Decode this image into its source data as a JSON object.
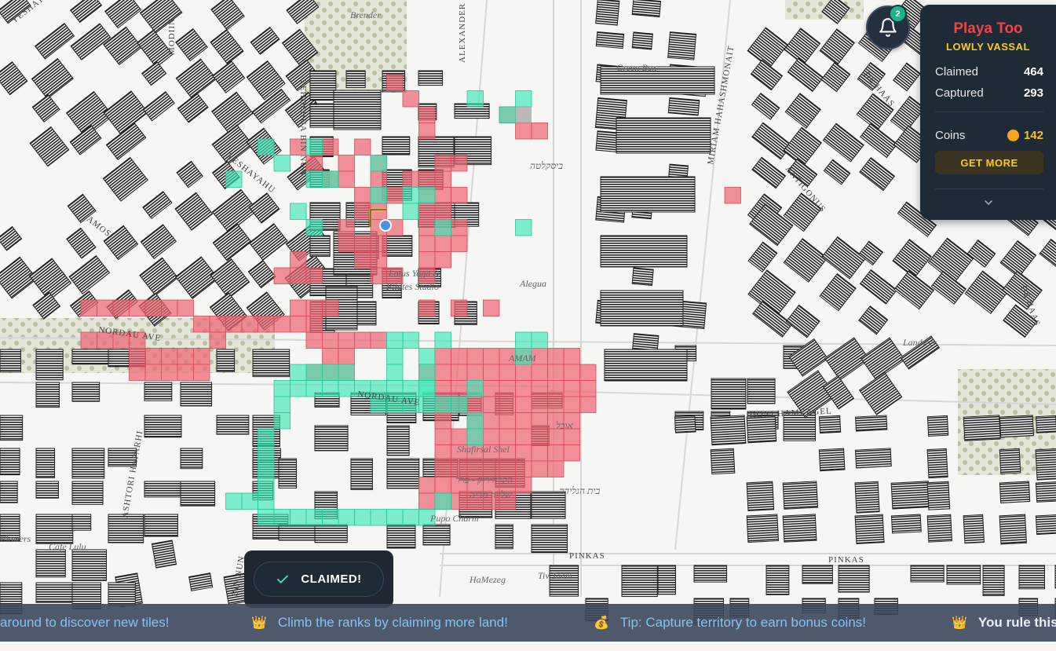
{
  "map": {
    "streets": [
      "YESHAYAHU",
      "YESHAYAHU",
      "MODIIN",
      "AMOS",
      "YEHOSHUA BIN NUN",
      "ALEXANDER YANAI",
      "NORDAU AVE",
      "NORDAU AVE",
      "MIRIAM HAHASHMONAIT",
      "DE HAAS",
      "DE HAAS",
      "ANTIGONUS",
      "HONI HAMEAGEL",
      "PINKAS",
      "PINKAS",
      "ASHTORI HAPARHI",
      "BIN NUN"
    ],
    "pois": [
      "Brender",
      "Green Box",
      "ביסקלטה",
      "Lotus Yoga &",
      "Pilates Studio",
      "Alegua",
      "AMAM",
      "Landwer",
      "אוכל",
      "Shafirsal Shel",
      "הקרהירוק - פרר",
      "שלווה מדיה",
      "Pupo Charm",
      "Cafe Lulu",
      "Flowers",
      "HaMezeg",
      "Tiv Taam",
      "בית הגלידה"
    ]
  },
  "notifications": {
    "count": "2"
  },
  "player": {
    "name": "Playa Too",
    "rank": "LOWLY VASSAL",
    "claimed_label": "Claimed",
    "claimed_value": "464",
    "captured_label": "Captured",
    "captured_value": "293",
    "coins_label": "Coins",
    "coins_value": "142",
    "get_more_label": "GET MORE"
  },
  "toast": {
    "label": "CLAIMED!"
  },
  "ticker": {
    "items": [
      {
        "icon": "",
        "text": "around to discover new tiles!"
      },
      {
        "icon": "crown-icon",
        "text": "Climb the ranks by claiming more land!"
      },
      {
        "icon": "money-bag-icon",
        "text": "Tip: Capture territory to earn bonus coins!"
      },
      {
        "icon": "crown-icon",
        "text": "You rule this"
      }
    ]
  },
  "colors": {
    "claimed_tile": "#ef6675",
    "captured_tile": "#3ee8b6",
    "panel_bg": "#1f2a37",
    "player_name": "#ef4444",
    "rank": "#facc15",
    "coin": "#f5a524"
  }
}
